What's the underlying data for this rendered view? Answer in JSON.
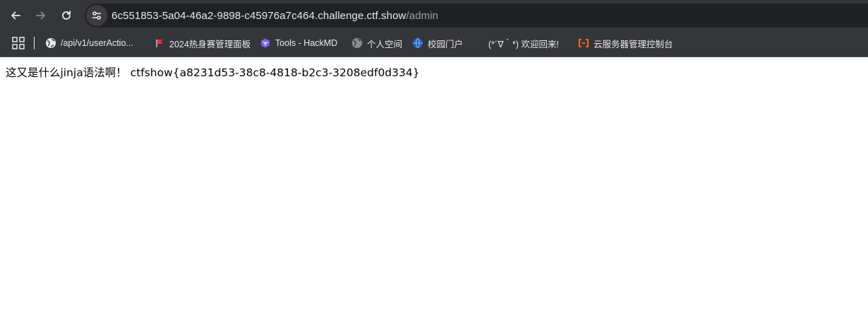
{
  "browser": {
    "url_host": "6c551853-5a04-46a2-9898-c45976a7c464.challenge.ctf.show",
    "url_path": "/admin",
    "bookmarks": [
      {
        "label": "/api/v1/userActio...",
        "icon": "globe-icon"
      },
      {
        "label": "2024热身赛管理面板",
        "icon": "ctfd-flag-icon"
      },
      {
        "label": "Tools - HackMD",
        "icon": "hackmd-icon"
      },
      {
        "label": "个人空间",
        "icon": "gray-globe-icon"
      },
      {
        "label": "校园门户",
        "icon": "campus-globe-icon"
      },
      {
        "label": "(*´∇｀*) 欢迎回来!",
        "icon": "blank-icon"
      },
      {
        "label": "云服务器管理控制台",
        "icon": "aliyun-icon"
      }
    ]
  },
  "page": {
    "message": "这又是什么jinja语法啊！ ctfshow{a8231d53-38c8-4818-b2c3-3208edf0d334}"
  },
  "colors": {
    "toolbar": "#35363a",
    "omnibox": "#202124",
    "accent_orange": "#ff6a00",
    "hackmd_purple": "#7b5cf0"
  }
}
